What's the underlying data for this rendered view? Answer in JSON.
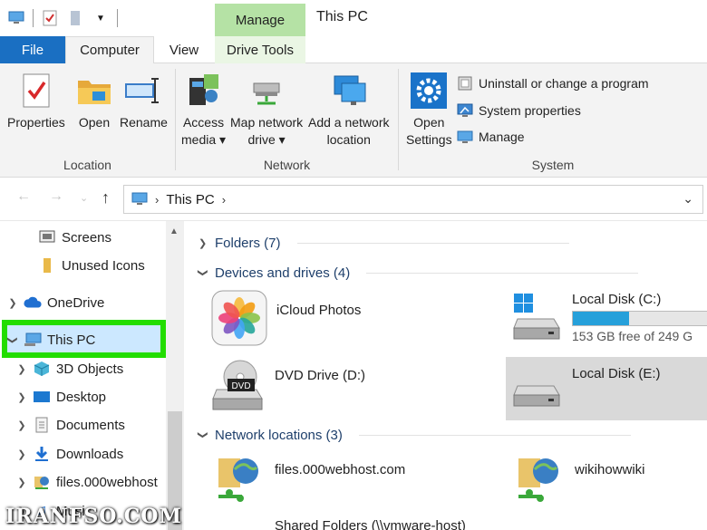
{
  "window": {
    "title": "This PC"
  },
  "ribbon_tabs": {
    "file": "File",
    "computer": "Computer",
    "view": "View",
    "contextual_group": "Manage",
    "drive_tools": "Drive Tools"
  },
  "ribbon": {
    "location": {
      "label": "Location",
      "properties": "Properties",
      "open": "Open",
      "rename": "Rename"
    },
    "network": {
      "label": "Network",
      "access_media": [
        "Access",
        "media ▾"
      ],
      "map_network_drive": [
        "Map network",
        "drive ▾"
      ],
      "add_network_location": [
        "Add a network",
        "location"
      ]
    },
    "system": {
      "label": "System",
      "open_settings": [
        "Open",
        "Settings"
      ],
      "uninstall": "Uninstall or change a program",
      "system_properties": "System properties",
      "manage": "Manage"
    }
  },
  "address": {
    "path": "This PC",
    "icons": {
      "back": "arrow-left-icon",
      "forward": "arrow-right-icon",
      "recent": "chevron-down-icon",
      "up": "arrow-up-icon"
    }
  },
  "nav_pane": {
    "items": [
      {
        "label": "Screens",
        "icon": "screen-icon"
      },
      {
        "label": "Unused Icons",
        "icon": "folder-icon"
      },
      {
        "label": "OneDrive",
        "icon": "cloud-icon"
      },
      {
        "label": "This PC",
        "icon": "computer-icon",
        "selected": true
      },
      {
        "label": "3D Objects",
        "icon": "cube-icon"
      },
      {
        "label": "Desktop",
        "icon": "desktop-icon"
      },
      {
        "label": "Documents",
        "icon": "document-icon"
      },
      {
        "label": "Downloads",
        "icon": "download-icon"
      },
      {
        "label": "files.000webhost",
        "icon": "network-drive-icon"
      },
      {
        "label": "Music",
        "icon": "music-icon"
      }
    ]
  },
  "content": {
    "folders": {
      "label": "Folders (7)"
    },
    "devices": {
      "label": "Devices and drives (4)",
      "icloud": {
        "name": "iCloud Photos"
      },
      "local_c": {
        "name": "Local Disk (C:)",
        "free_text": "153 GB free of 249 G",
        "used_fraction": 0.39
      },
      "dvd": {
        "name": "DVD Drive (D:)",
        "badge": "DVD"
      },
      "local_e": {
        "name": "Local Disk (E:)"
      }
    },
    "network_locations": {
      "label": "Network locations (3)",
      "items": [
        {
          "name": "files.000webhost.com"
        },
        {
          "name": "wikihowwiki"
        },
        {
          "name": "Shared Folders (\\\\vmware-host)"
        }
      ]
    }
  },
  "watermark": "IRANFSO.COM",
  "colors": {
    "file_tab": "#1a6fc2",
    "manage_tab": "#b5e2a5",
    "highlight": "#22dd00",
    "drive_bar": "#26a0da",
    "selection": "#cce8ff"
  }
}
